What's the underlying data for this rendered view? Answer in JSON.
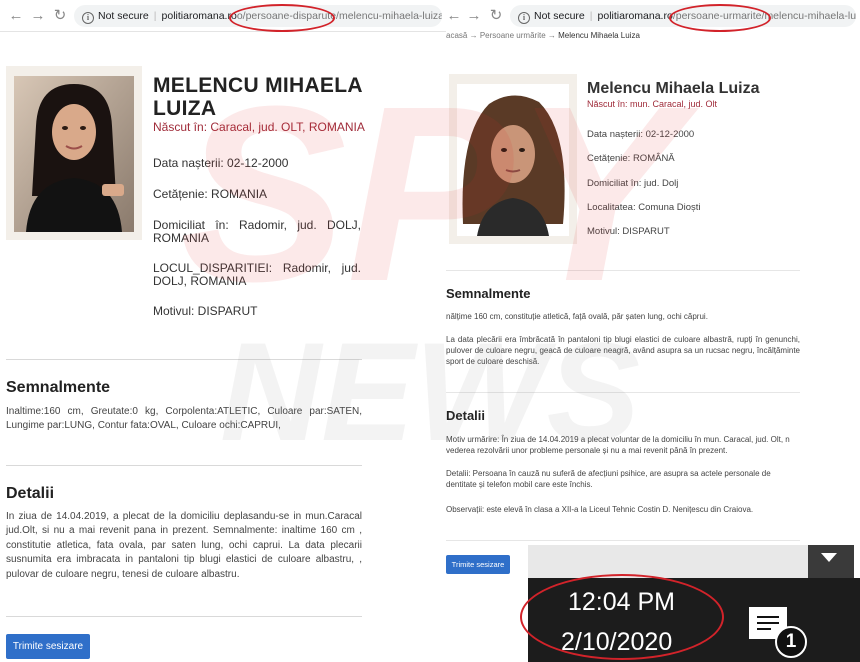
{
  "left": {
    "url": {
      "security": "Not secure",
      "host": "politiaromana.ro",
      "path_prefix": "/p",
      "path": "o/persoane-disparute/",
      "path_suffix": "melencu-mihaela-luiza"
    },
    "name": "MELENCU MIHAELA LUIZA",
    "born": "Născut în: Caracal, jud. OLT, ROMANIA",
    "birth_date": "Data nașterii: 02-12-2000",
    "citizenship": "Cetățenie: ROMANIA",
    "domicile": "Domiciliat în: Radomir, jud. DOLJ, ROMANIA",
    "disappearance_place": "LOCUL_DISPARITIEI: Radomir, jud. DOLJ, ROMANIA",
    "reason": "Motivul: DISPARUT",
    "signs_title": "Semnalmente",
    "signs_text": "Inaltime:160 cm, Greutate:0 kg, Corpolenta:ATLETIC, Culoare par:SATEN, Lungime par:LUNG, Contur fata:OVAL, Culoare ochi:CAPRUI,",
    "details_title": "Detalii",
    "details_text": "In ziua de 14.04.2019, a plecat de la domiciliu deplasandu-se in mun.Caracal jud.Olt, si nu a mai revenit pana in prezent. Semnalmente: inaltime 160 cm , constitutie atletica, fata ovala, par saten lung, ochi caprui. La data plecarii susnumita era imbracata in pantaloni tip blugi elastici de culoare albastru, , pulovar de culoare negru, tenesi de culoare albastru.",
    "send_button": "Trimite sesizare"
  },
  "right": {
    "url": {
      "security": "Not secure",
      "host": "politiaromana.ro",
      "path": "/persoane-urmarite/",
      "path_suffix": "melencu-mihaela-luiza"
    },
    "breadcrumb": [
      "acasă",
      "Persoane urmărite",
      "Melencu Mihaela Luiza"
    ],
    "name": "Melencu Mihaela Luiza",
    "born": "Născut în: mun. Caracal, jud. Olt",
    "birth_date": "Data nașterii: 02-12-2000",
    "citizenship": "Cetățenie: ROMÂNĂ",
    "domicile": "Domiciliat în: jud. Dolj",
    "locality": "Localitatea: Comuna Dioști",
    "reason": "Motivul: DISPARUT",
    "signs_title": "Semnalmente",
    "signs_1": "nălțime 160 cm, constituție atletică, față ovală, păr șaten lung, ochi căprui.",
    "signs_2": "La data plecării era îmbrăcată în pantaloni tip blugi elastici de culoare albastră, rupți în genunchi, pulover de culoare negru, geacă de culoare neagră, având asupra sa un rucsac negru, încălțăminte sport de culoare deschisă.",
    "details_title": "Detalii",
    "details_1": "Motiv urmărire: În ziua de 14.04.2019 a plecat voluntar de la domiciliu în mun. Caracal, jud. Olt, n vederea rezolvării unor probleme personale și nu a mai revenit până în prezent.",
    "details_2": "Detalii: Persoana în cauză nu suferă de afecțiuni psihice, are asupra sa actele personale de dentitate și telefon mobil care este închis.",
    "details_3": "Observații: este elevă în clasa a XII-a la Liceul Tehnic Costin D. Nenițescu din Craiova.",
    "send_button": "Trimite sesizare"
  },
  "taskbar": {
    "time": "12:04 PM",
    "date": "2/10/2020",
    "notification_count": "1"
  },
  "watermark": {
    "line1": "SPY",
    "line2": "NEWS"
  },
  "colors": {
    "accent_red": "#d2232a",
    "button_blue": "#2f6fc9",
    "born_text": "#a02c3a"
  },
  "icons": [
    "back-arrow-icon",
    "forward-arrow-icon",
    "reload-icon",
    "info-icon",
    "chevron-down-icon",
    "notification-icon"
  ]
}
